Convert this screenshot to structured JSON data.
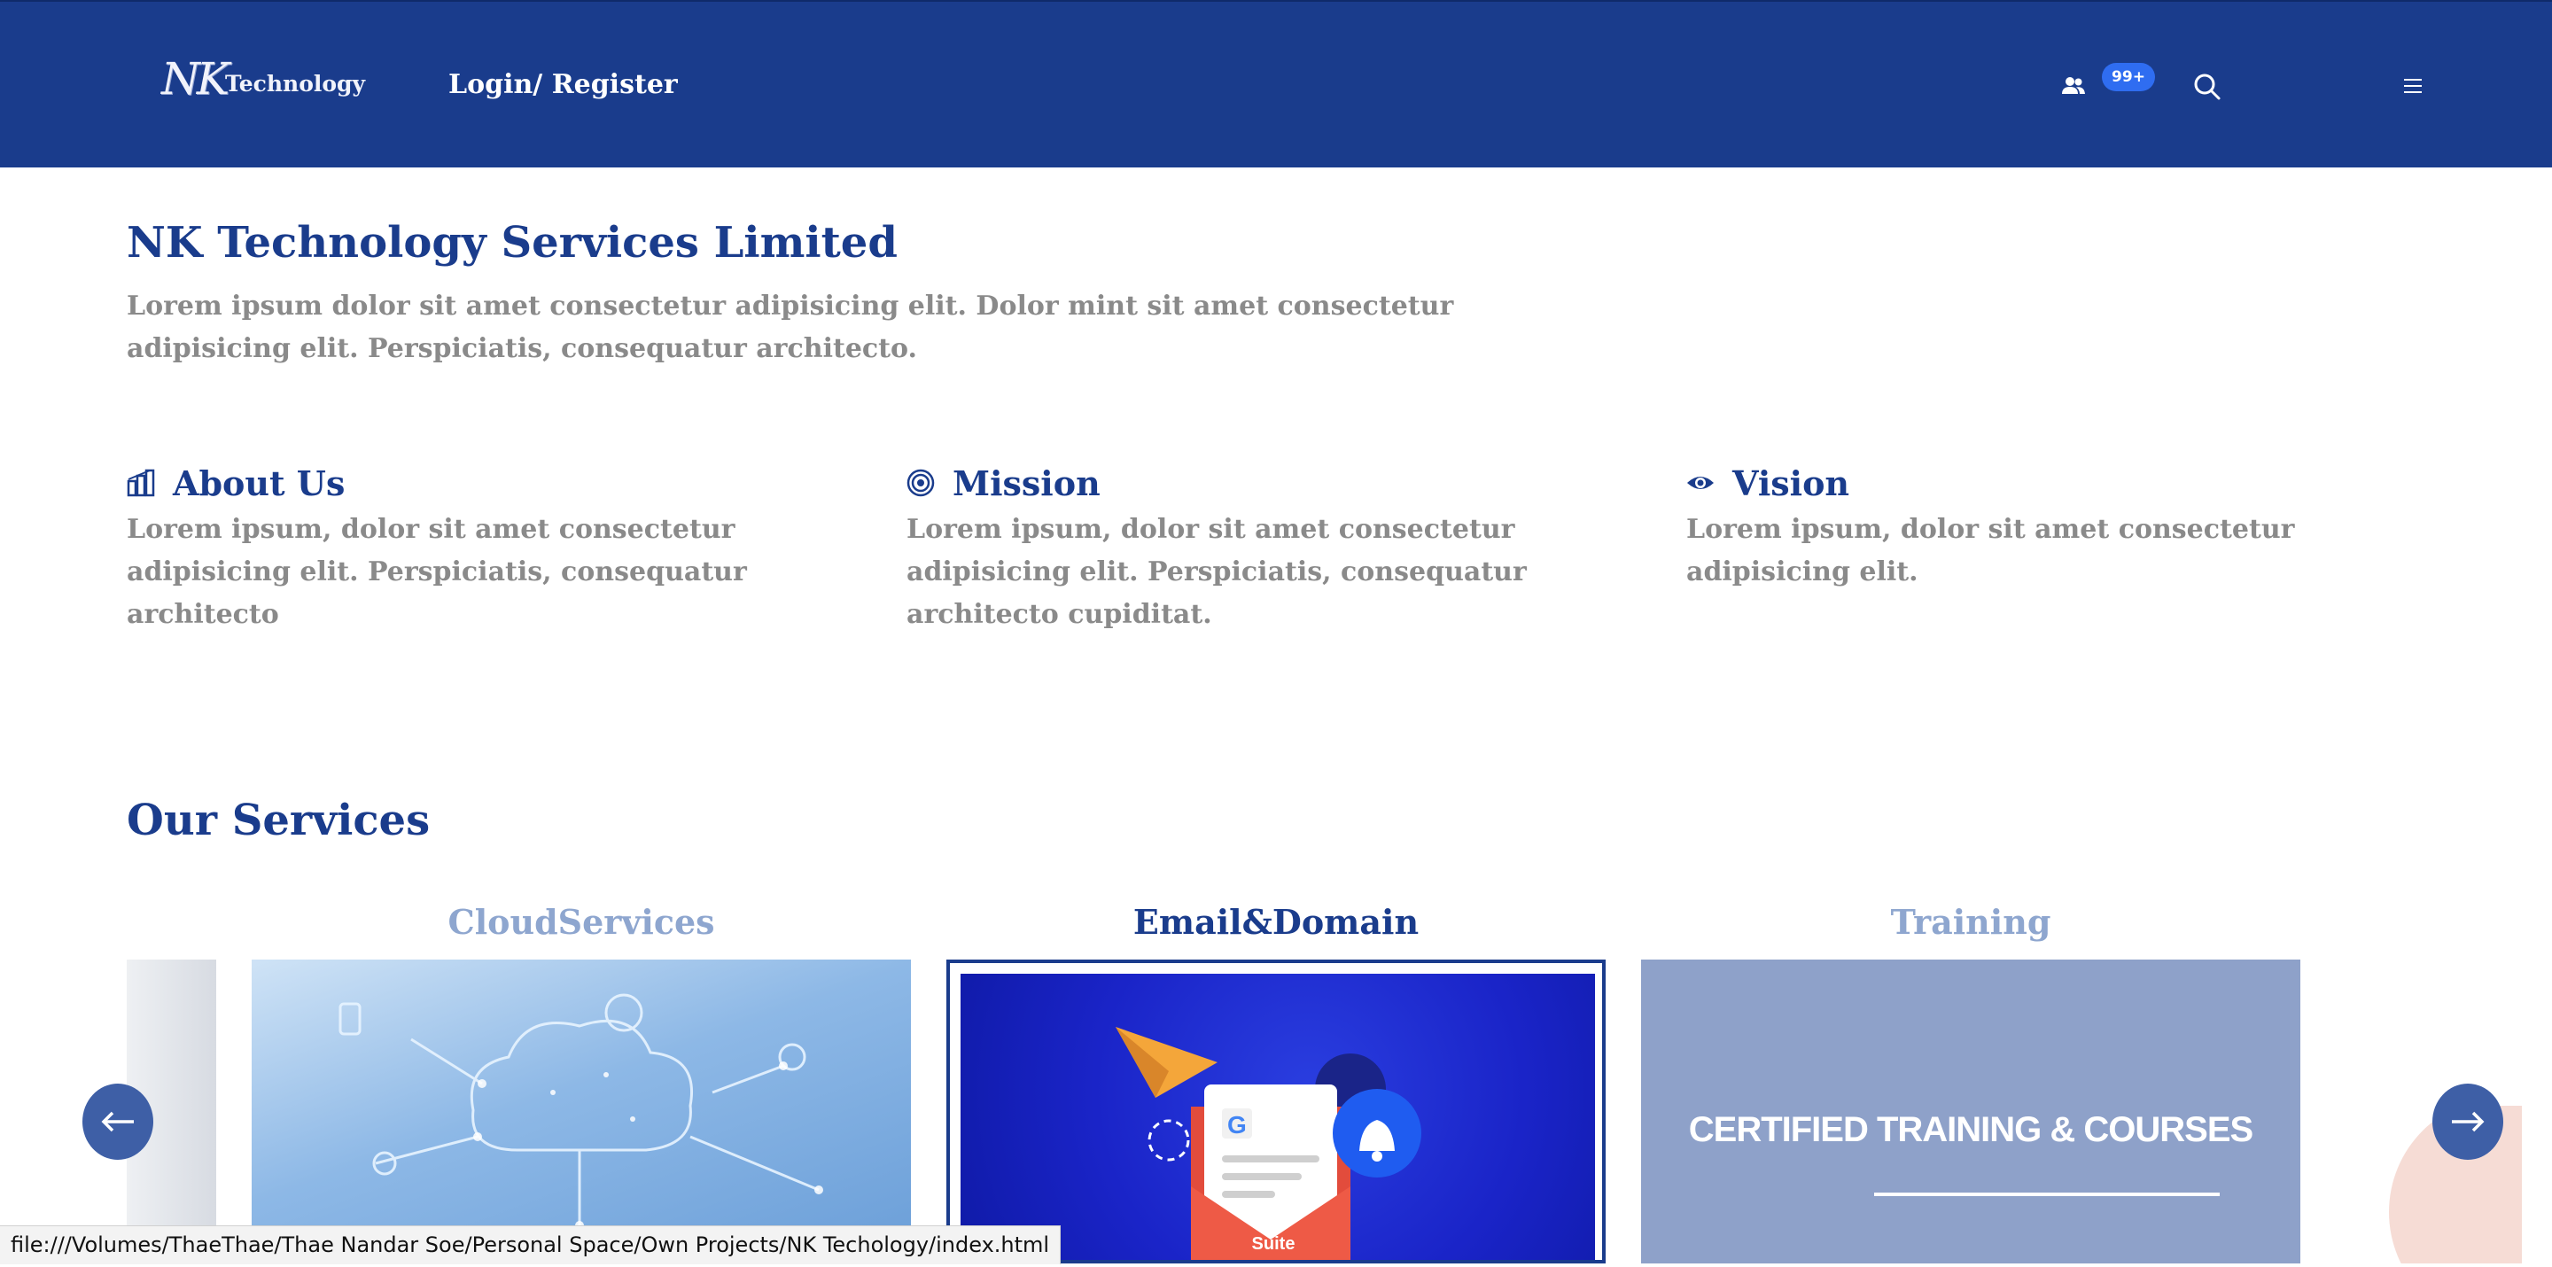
{
  "header": {
    "logo_text_1": "NK",
    "logo_text_2": "Technology",
    "login_label": "Login/ Register",
    "notification_badge": "99+",
    "icons": [
      "users-icon",
      "search-icon",
      "hamburger-menu-icon"
    ]
  },
  "intro": {
    "title": "NK Technology Services Limited",
    "text": "Lorem ipsum dolor sit amet consectetur adipisicing elit. Dolor mint sit amet consectetur adipisicing elit. Perspiciatis, consequatur architecto."
  },
  "features": [
    {
      "icon": "building-chart-icon",
      "title": "About Us",
      "text": "Lorem ipsum, dolor sit amet consectetur adipisicing elit. Perspiciatis, consequatur architecto"
    },
    {
      "icon": "target-icon",
      "title": "Mission",
      "text": "Lorem ipsum, dolor sit amet consectetur adipisicing elit. Perspiciatis, consequatur architecto cupiditat."
    },
    {
      "icon": "eye-icon",
      "title": "Vision",
      "text": "Lorem ipsum, dolor sit amet consectetur adipisicing elit."
    }
  ],
  "services": {
    "title": "Our Services",
    "items": [
      {
        "label": "CloudServices",
        "active": false
      },
      {
        "label": "Email&Domain",
        "active": true
      },
      {
        "label": "Training",
        "active": false
      }
    ],
    "email_card_text": "Suite",
    "training_card_text": "CERTIFIED TRAINING & COURSES"
  },
  "colors": {
    "header_bg": "#1a3c8c",
    "primary": "#1a3c8c",
    "muted_text": "#8a8a8a",
    "inactive_label": "#8ea6cf",
    "badge": "#2f6df1"
  },
  "status_bar": "file:///Volumes/ThaeThae/Thae Nandar Soe/Personal Space/Own Projects/NK Techology/index.html"
}
